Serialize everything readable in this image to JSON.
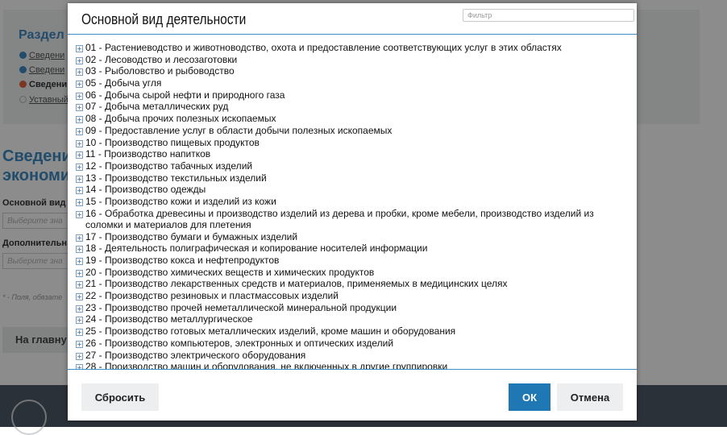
{
  "background": {
    "section_title": "Раздел",
    "steps": [
      {
        "label": "Сведени",
        "state": "done"
      },
      {
        "label": "Сведени",
        "state": "done"
      },
      {
        "label": "Сведени",
        "state": "current"
      },
      {
        "label": "Уставный",
        "state": "pending"
      }
    ],
    "heading_line1": "Сведени",
    "heading_line2": "экономи",
    "field1_label": "Основной вид",
    "field1_placeholder": "Выберите зна",
    "field2_label": "Дополнительн",
    "field2_placeholder": "Выберите зна",
    "required_note": "* - Поля, обязате",
    "home_button": "На главну"
  },
  "modal": {
    "title": "Основной вид деятельности",
    "filter_placeholder": "Фильтр",
    "expand_symbol": "+",
    "items": [
      "01 - Растениеводство и животноводство, охота и предоставление соответствующих услуг в этих областях",
      "02 - Лесоводство и лесозаготовки",
      "03 - Рыболовство и рыбоводство",
      "05 - Добыча угля",
      "06 - Добыча сырой нефти и природного газа",
      "07 - Добыча металлических руд",
      "08 - Добыча прочих полезных ископаемых",
      "09 - Предоставление услуг в области добычи полезных ископаемых",
      "10 - Производство пищевых продуктов",
      "11 - Производство напитков",
      "12 - Производство табачных изделий",
      "13 - Производство текстильных изделий",
      "14 - Производство одежды",
      "15 - Производство кожи и изделий из кожи",
      "16 - Обработка древесины и производство изделий из дерева и пробки, кроме мебели, производство изделий из соломки и материалов для плетения",
      "17 - Производство бумаги и бумажных изделий",
      "18 - Деятельность полиграфическая и копирование носителей информации",
      "19 - Производство кокса и нефтепродуктов",
      "20 - Производство химических веществ и химических продуктов",
      "21 - Производство лекарственных средств и материалов, применяемых в медицинских целях",
      "22 - Производство резиновых и пластмассовых изделий",
      "23 - Производство прочей неметаллической минеральной продукции",
      "24 - Производство металлургическое",
      "25 - Производство готовых металлических изделий, кроме машин и оборудования",
      "26 - Производство компьютеров, электронных и оптических изделий",
      "27 - Производство электрического оборудования",
      "28 - Производство машин и оборудования, не включенных в другие группировки"
    ],
    "buttons": {
      "reset": "Сбросить",
      "ok": "ОК",
      "cancel": "Отмена"
    }
  },
  "colors": {
    "accent": "#1f78b4",
    "heading_blue": "#3f8ac4",
    "divider": "#3c8fc8",
    "step_done": "#3f8ac4",
    "step_current": "#e0643c",
    "step_pending": "#bbbbbb"
  }
}
